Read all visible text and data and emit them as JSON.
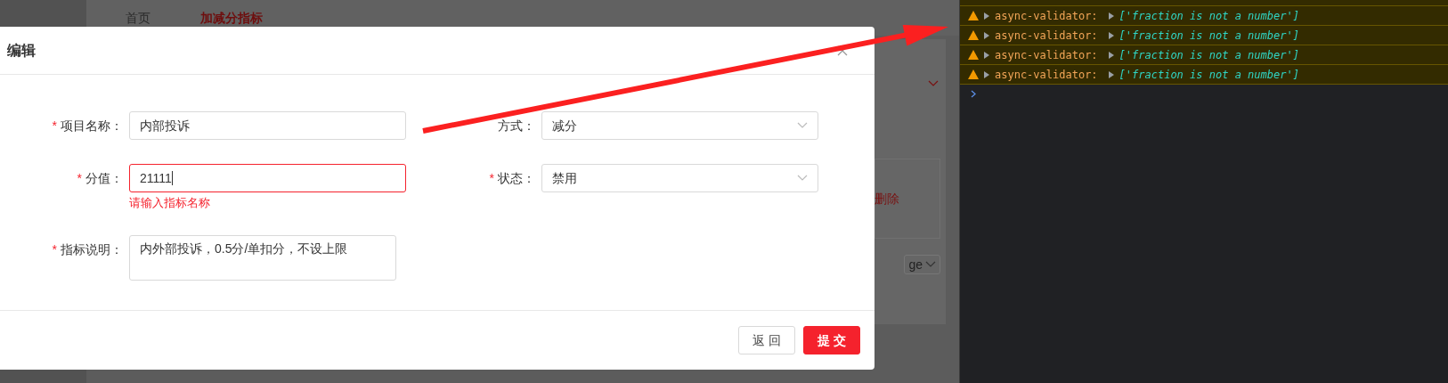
{
  "nav": {
    "tabs": [
      {
        "label": "首页",
        "selected": false
      },
      {
        "label": "加减分指标",
        "selected": true
      }
    ]
  },
  "background_panel": {
    "action_link": "删除",
    "pager_text": "ge"
  },
  "dialog": {
    "title": "编辑",
    "fields": [
      {
        "kind": "input",
        "required_mark": "*",
        "label": "项目名称：",
        "value": "内部投诉",
        "error": false
      },
      {
        "kind": "select",
        "label": "方式：",
        "value": "减分",
        "error": false
      },
      {
        "kind": "input",
        "required_mark": "*",
        "label": "分值：",
        "value": "21111",
        "error": true,
        "error_message": "请输入指标名称"
      },
      {
        "kind": "select",
        "required_mark": "*",
        "label": "状态：",
        "value": "禁用",
        "error": false
      },
      {
        "kind": "textarea",
        "required_mark": "*",
        "label": "指标说明：",
        "value": "内外部投诉，0.5分/单扣分，不设上限",
        "error": false
      }
    ],
    "buttons": [
      {
        "label": "返 回",
        "kind": "default"
      },
      {
        "label": "提 交",
        "kind": "primary"
      }
    ]
  },
  "console": {
    "messages": [
      {
        "source": "async-validator:",
        "value": "['fraction is not a number']"
      },
      {
        "source": "async-validator:",
        "value": "['fraction is not a number']"
      },
      {
        "source": "async-validator:",
        "value": "['fraction is not a number']"
      },
      {
        "source": "async-validator:",
        "value": "['fraction is not a number']"
      }
    ]
  }
}
